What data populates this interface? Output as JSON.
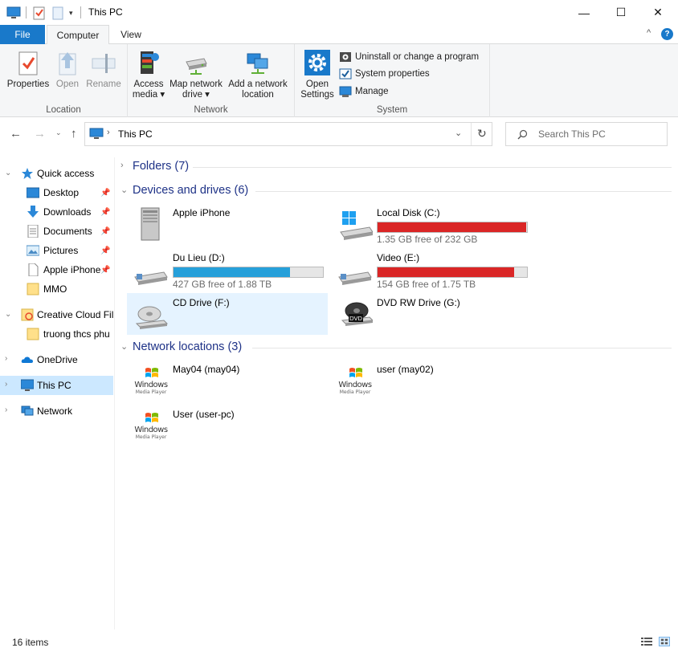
{
  "window": {
    "title": "This PC",
    "minimize_glyph": "—",
    "maximize_glyph": "☐",
    "close_glyph": "✕"
  },
  "ribbon_tabs": {
    "file": "File",
    "computer": "Computer",
    "view": "View",
    "collapse_glyph": "^",
    "help_glyph": "?"
  },
  "ribbon": {
    "location": {
      "label": "Location",
      "properties": "Properties",
      "open": "Open",
      "rename": "Rename"
    },
    "network": {
      "label": "Network",
      "access_media_1": "Access",
      "access_media_2": "media ▾",
      "map_drive_1": "Map network",
      "map_drive_2": "drive ▾",
      "add_location_1": "Add a network",
      "add_location_2": "location"
    },
    "system": {
      "label": "System",
      "open_settings_1": "Open",
      "open_settings_2": "Settings",
      "uninstall": "Uninstall or change a program",
      "system_properties": "System properties",
      "manage": "Manage"
    }
  },
  "address": {
    "path": "This PC",
    "search_placeholder": "Search This PC"
  },
  "nav_pane": {
    "items": [
      {
        "label": "Quick access"
      },
      {
        "label": "Desktop"
      },
      {
        "label": "Downloads"
      },
      {
        "label": "Documents"
      },
      {
        "label": "Pictures"
      },
      {
        "label": "Apple iPhone"
      },
      {
        "label": "MMO"
      },
      {
        "label": "Creative Cloud Fil"
      },
      {
        "label": "truong thcs phu"
      },
      {
        "label": "OneDrive"
      },
      {
        "label": "This PC"
      },
      {
        "label": "Network"
      }
    ]
  },
  "content": {
    "folders_header": "Folders (7)",
    "devices_header": "Devices and drives (6)",
    "network_header": "Network locations (3)",
    "devices": [
      {
        "name": "Apple iPhone",
        "free": "",
        "used_fraction": null
      },
      {
        "name": "Local Disk (C:)",
        "free": "1.35 GB free of 232 GB",
        "used_fraction": 0.994,
        "bar_color": "#da2626"
      },
      {
        "name": "Du Lieu (D:)",
        "free": "427 GB free of 1.88 TB",
        "used_fraction": 0.778,
        "bar_color": "#26a0da"
      },
      {
        "name": "Video (E:)",
        "free": "154 GB free of 1.75 TB",
        "used_fraction": 0.912,
        "bar_color": "#da2626"
      },
      {
        "name": "CD Drive (F:)",
        "free": "",
        "used_fraction": null
      },
      {
        "name": "DVD RW Drive (G:)",
        "free": "",
        "used_fraction": null,
        "badge": "DVD"
      }
    ],
    "network_locations": [
      {
        "name": "May04 (may04)"
      },
      {
        "name": "user (may02)"
      },
      {
        "name": "User (user-pc)"
      }
    ],
    "wmp_text_1": "Windows",
    "wmp_text_2": "Media Player"
  },
  "status_bar": {
    "count": "16 items"
  }
}
